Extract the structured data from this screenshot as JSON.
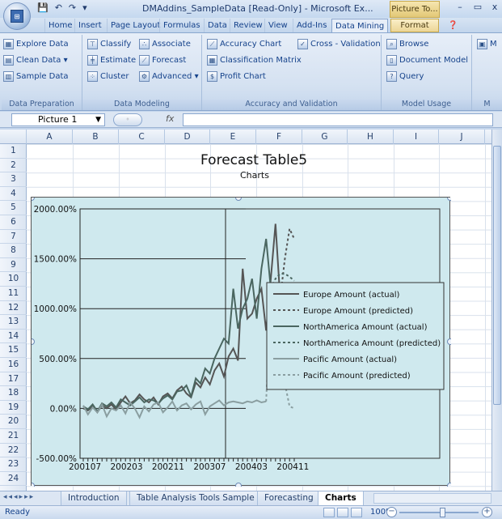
{
  "window": {
    "title": "DMAddins_SampleData  [Read-Only] - Microsoft Ex...",
    "context_tab": "Picture To...",
    "minimize": "–",
    "maximize": "▭",
    "close": "x"
  },
  "qat": [
    "💾",
    "↶",
    "↷",
    "▾"
  ],
  "tabs": [
    "Home",
    "Insert",
    "Page Layout",
    "Formulas",
    "Data",
    "Review",
    "View",
    "Add-Ins",
    "Data Mining",
    "Format"
  ],
  "active_tab": "Data Mining",
  "ribbon": {
    "groups": [
      {
        "label": "Data Preparation",
        "buttons": [
          "Explore Data",
          "Clean Data ▾",
          "Sample Data"
        ]
      },
      {
        "label": "Data Modeling",
        "buttons": [
          "Classify",
          "Associate",
          "Estimate",
          "Forecast",
          "Cluster",
          "Advanced ▾"
        ]
      },
      {
        "label": "Accuracy and Validation",
        "buttons": [
          "Accuracy Chart",
          "Cross - Validation",
          "Classification Matrix",
          "Profit Chart"
        ]
      },
      {
        "label": "Model Usage",
        "buttons": [
          "Browse",
          "Document Model",
          "Query"
        ]
      },
      {
        "label": "M",
        "buttons": [
          "M"
        ]
      }
    ]
  },
  "formula_bar": {
    "name_box": "Picture 1",
    "fx": "fx",
    "value": ""
  },
  "columns": [
    "A",
    "B",
    "C",
    "D",
    "E",
    "F",
    "G",
    "H",
    "I",
    "J"
  ],
  "rows": [
    "1",
    "2",
    "3",
    "4",
    "5",
    "6",
    "7",
    "8",
    "9",
    "10",
    "11",
    "12",
    "13",
    "14",
    "15",
    "16",
    "17",
    "18",
    "19",
    "20",
    "21",
    "22",
    "23",
    "24"
  ],
  "sheet": {
    "title": "Forecast Table5",
    "subtitle": "Charts"
  },
  "chart_data": {
    "type": "line",
    "title": "",
    "xlabel": "",
    "ylabel": "",
    "ylim": [
      -500,
      2000
    ],
    "y_ticks": [
      "2000.00%",
      "1500.00%",
      "1000.00%",
      "500.00%",
      "0.00%",
      "-500.00%"
    ],
    "x_ticks": [
      "200107",
      "200203",
      "200211",
      "200307",
      "200403",
      "200411"
    ],
    "x_count": 46,
    "legend_position": "right",
    "series": [
      {
        "name": "Europe Amount (actual)",
        "color": "#555555",
        "dash": "",
        "start": 0,
        "values": [
          0,
          -20,
          20,
          -40,
          30,
          0,
          40,
          -10,
          60,
          120,
          50,
          80,
          140,
          90,
          60,
          110,
          40,
          120,
          150,
          100,
          180,
          220,
          150,
          110,
          260,
          210,
          310,
          240,
          380,
          450,
          320,
          520,
          600,
          480,
          1400,
          900,
          950,
          1100,
          1200,
          780,
          1300,
          1850,
          1100
        ]
      },
      {
        "name": "Europe Amount (predicted)",
        "color": "#555555",
        "dash": "3,3",
        "start": 42,
        "values": [
          1100,
          1500,
          1800,
          1700
        ]
      },
      {
        "name": "NorthAmerica Amount (actual)",
        "color": "#4a6660",
        "dash": "",
        "start": 0,
        "values": [
          20,
          -10,
          40,
          -30,
          50,
          20,
          60,
          10,
          90,
          60,
          30,
          70,
          110,
          60,
          90,
          80,
          50,
          100,
          130,
          90,
          170,
          180,
          230,
          120,
          300,
          250,
          400,
          350,
          500,
          600,
          700,
          650,
          1200,
          800,
          1000,
          1100,
          1300,
          900,
          1400,
          1700,
          1200
        ]
      },
      {
        "name": "NorthAmerica Amount (predicted)",
        "color": "#4a6660",
        "dash": "3,3",
        "start": 40,
        "values": [
          1200,
          1300,
          1350,
          1350,
          1320,
          1280
        ]
      },
      {
        "name": "Pacific Amount (actual)",
        "color": "#8a9ea0",
        "dash": "",
        "start": 0,
        "values": [
          30,
          -60,
          10,
          -40,
          40,
          -80,
          0,
          -20,
          30,
          -50,
          60,
          0,
          -90,
          20,
          -30,
          40,
          60,
          -40,
          10,
          70,
          -20,
          30,
          50,
          -10,
          40,
          70,
          -60,
          20,
          50,
          80,
          30,
          60,
          70,
          60,
          50,
          70,
          60,
          80,
          60,
          70
        ]
      },
      {
        "name": "Pacific Amount (predicted)",
        "color": "#8a9ea0",
        "dash": "3,3",
        "start": 39,
        "values": [
          70,
          1100,
          700,
          400,
          250,
          20,
          0
        ]
      }
    ]
  },
  "sheet_tabs": [
    "Introduction",
    "Table Analysis Tools Sample",
    "Forecasting",
    "Charts"
  ],
  "active_sheet": "Charts",
  "status": {
    "ready": "Ready",
    "zoom": "100%"
  }
}
